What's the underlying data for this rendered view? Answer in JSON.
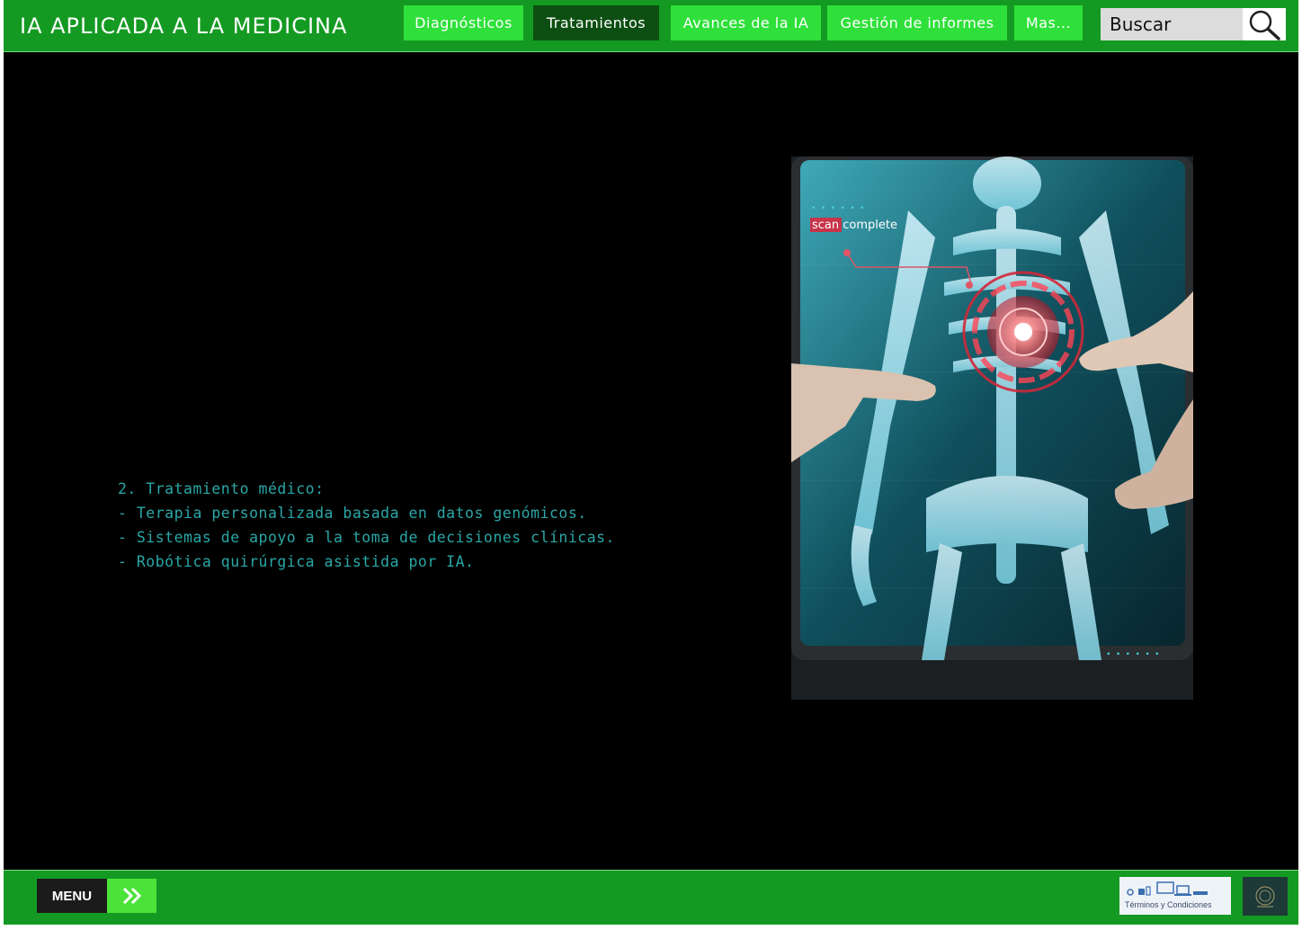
{
  "header": {
    "title": "IA APLICADA A LA MEDICINA",
    "nav": [
      {
        "label": "Diagnósticos"
      },
      {
        "label": "Tratamientos",
        "active": true
      },
      {
        "label": "Avances de la IA"
      },
      {
        "label": "Gestión de informes"
      },
      {
        "label": "Mas..."
      }
    ],
    "search": {
      "placeholder": "Buscar"
    }
  },
  "content": {
    "heading": "2. Tratamiento médico:",
    "lines": [
      "- Terapia personalizada basada en datos genómicos.",
      "- Sistemas de apoyo a la toma de decisiones clínicas.",
      "- Robótica quirúrgica asistida por IA."
    ],
    "image_overlay_text": "scan complete"
  },
  "footer": {
    "menu_label": "MENU",
    "terms_label": "Términos y Condiciones"
  },
  "colors": {
    "header_green": "#149a22",
    "nav_green": "#2fe03a",
    "nav_active": "#0d4f12",
    "text_teal": "#2aa7a7",
    "background": "#000000"
  }
}
